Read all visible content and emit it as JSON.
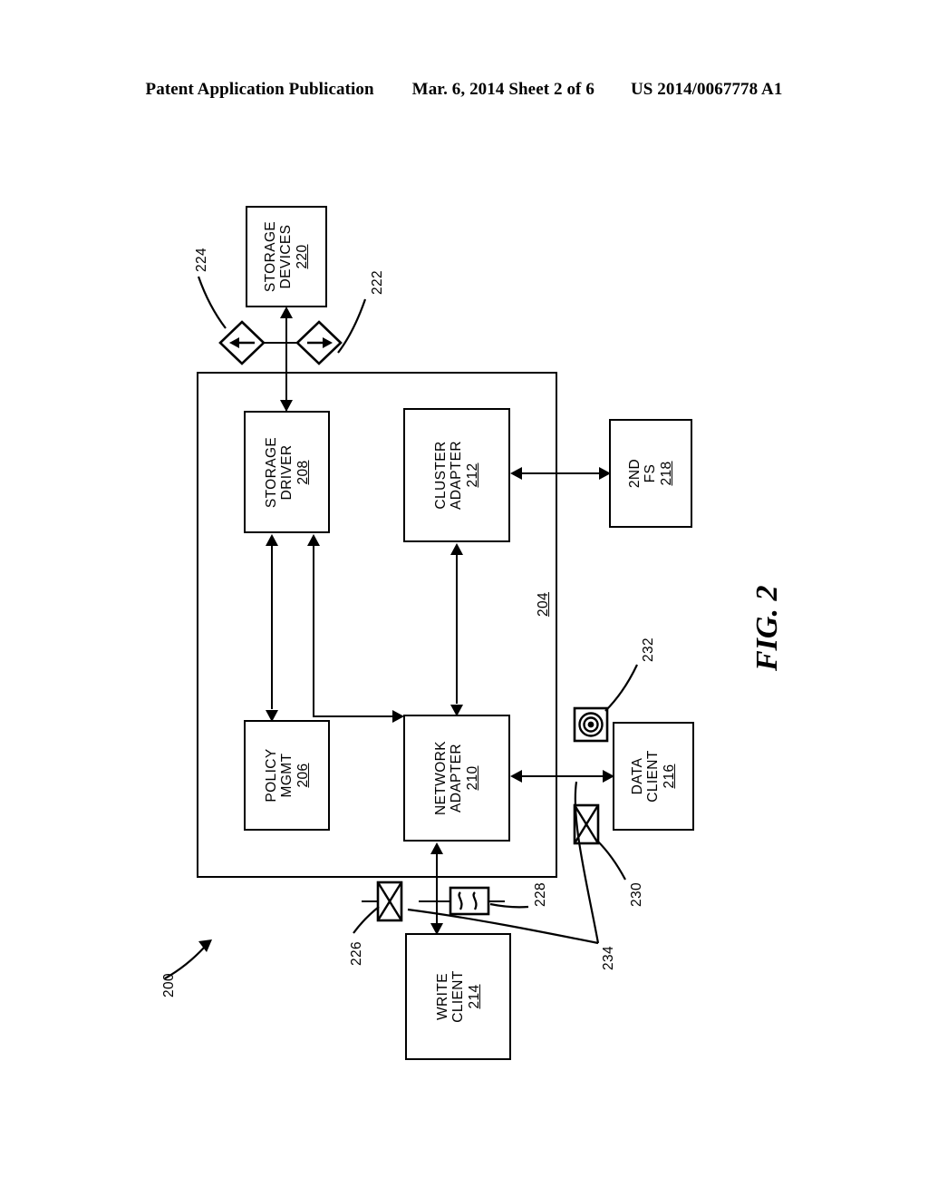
{
  "header": {
    "publication": "Patent Application Publication",
    "date_sheet": "Mar. 6, 2014   Sheet 2 of 6",
    "patent_number": "US 2014/0067778 A1"
  },
  "figure": {
    "label": "FIG. 2",
    "system_ref": "200",
    "container_ref": "204"
  },
  "blocks": {
    "storage_devices": {
      "line1": "STORAGE",
      "line2": "DEVICES",
      "num": "220"
    },
    "storage_driver": {
      "line1": "STORAGE",
      "line2": "DRIVER",
      "num": "208"
    },
    "cluster_adapter": {
      "line1": "CLUSTER",
      "line2": "ADAPTER",
      "num": "212"
    },
    "second_fs": {
      "line1": "2ND",
      "line2": "FS",
      "num": "218"
    },
    "policy_mgmt": {
      "line1": "POLICY",
      "line2": "MGMT",
      "num": "206"
    },
    "network_adapter": {
      "line1": "NETWORK",
      "line2": "ADAPTER",
      "num": "210"
    },
    "data_client": {
      "line1": "DATA",
      "line2": "CLIENT",
      "num": "216"
    },
    "write_client": {
      "line1": "WRITE",
      "line2": "CLIENT",
      "num": "214"
    }
  },
  "refs": {
    "r200": "200",
    "r204": "204",
    "r222": "222",
    "r224": "224",
    "r226": "226",
    "r228": "228",
    "r230": "230",
    "r232": "232",
    "r234": "234"
  },
  "symbols": {
    "diamond_read": {
      "name": "diamond-arrow-left",
      "ref": "224"
    },
    "diamond_write": {
      "name": "diamond-arrow-right",
      "ref": "222"
    },
    "bowtie_226": {
      "name": "bowtie-x-box",
      "ref": "226"
    },
    "wave_228": {
      "name": "wave-squiggle-box",
      "ref": "228"
    },
    "bowtie_230": {
      "name": "bowtie-x-box",
      "ref": "230"
    },
    "target_232": {
      "name": "bullseye-target-box",
      "ref": "232"
    }
  },
  "colors": {
    "ink": "#000000",
    "paper": "#ffffff"
  }
}
